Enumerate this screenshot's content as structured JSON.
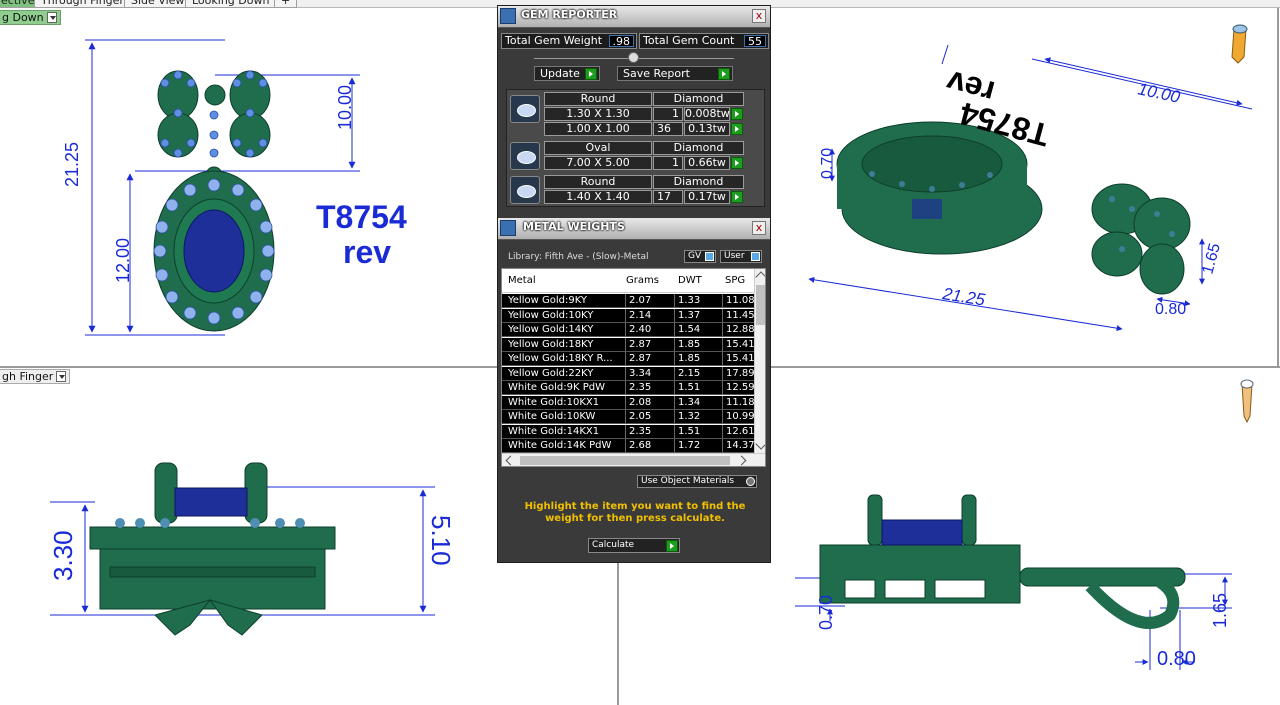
{
  "tabs": [
    "ective",
    "Through Finger",
    "Side View",
    "Looking Down",
    "+"
  ],
  "viewports": {
    "top_left_label": "g Down",
    "bottom_left_label": "gh Finger",
    "top_left": {
      "text_line1": "T8754",
      "text_line2": "rev",
      "dim_total": "21.25",
      "dim_top": "10.00",
      "dim_bottom": "12.00"
    },
    "top_right": {
      "dim_width": "10.00",
      "dim_length": "21.25",
      "dim_a": "0.70",
      "dim_b": "1.65",
      "dim_c": "0.80",
      "engraving_1": "T8754",
      "engraving_2": "rev"
    },
    "bottom_left": {
      "dim_left": "3.30",
      "dim_right": "5.10"
    },
    "bottom_right": {
      "dim_a": "0.70",
      "dim_b": "1.65",
      "dim_c": "0.80"
    }
  },
  "gem_reporter": {
    "title": "GEM REPORTER",
    "close": "x",
    "total_weight_label": "Total Gem Weight",
    "total_weight_value": ".98",
    "total_count_label": "Total Gem Count",
    "total_count_value": "55",
    "update_label": "Update",
    "save_label": "Save Report",
    "groups": [
      {
        "shape": "Round",
        "material": "Diamond",
        "rows": [
          {
            "size": "1.30 X 1.30",
            "count": "1",
            "weight": "0.008tw"
          },
          {
            "size": "1.00 X 1.00",
            "count": "36",
            "weight": "0.13tw"
          }
        ]
      },
      {
        "shape": "Oval",
        "material": "Diamond",
        "rows": [
          {
            "size": "7.00 X 5.00",
            "count": "1",
            "weight": "0.66tw"
          }
        ]
      },
      {
        "shape": "Round",
        "material": "Diamond",
        "rows": [
          {
            "size": "1.40 X 1.40",
            "count": "17",
            "weight": "0.17tw"
          }
        ]
      }
    ]
  },
  "metal_weights": {
    "title": "METAL WEIGHTS",
    "close": "x",
    "library": "Library: Fifth Ave - (Slow)-Metal",
    "gv_label": "GV",
    "user_label": "User",
    "columns": [
      "Metal",
      "Grams",
      "DWT",
      "SPG"
    ],
    "rows": [
      [
        "Yellow Gold:9KY",
        "2.07",
        "1.33",
        "11.08"
      ],
      [
        "Yellow Gold:10KY",
        "2.14",
        "1.37",
        "11.45"
      ],
      [
        "Yellow Gold:14KY",
        "2.40",
        "1.54",
        "12.88"
      ],
      [
        "Yellow Gold:18KY",
        "2.87",
        "1.85",
        "15.41"
      ],
      [
        "Yellow Gold:18KY R...",
        "2.87",
        "1.85",
        "15.41"
      ],
      [
        "Yellow Gold:22KY",
        "3.34",
        "2.15",
        "17.89"
      ],
      [
        "White Gold:9K PdW",
        "2.35",
        "1.51",
        "12.59"
      ],
      [
        "White Gold:10KX1",
        "2.08",
        "1.34",
        "11.18"
      ],
      [
        "White Gold:10KW",
        "2.05",
        "1.32",
        "10.99"
      ],
      [
        "White Gold:14KX1",
        "2.35",
        "1.51",
        "12.61"
      ],
      [
        "White Gold:14K PdW",
        "2.68",
        "1.72",
        "14.37"
      ]
    ],
    "use_object_materials": "Use Object Materials",
    "hint": "Highlight the item you want to find the weight for then press calculate.",
    "calculate": "Calculate"
  },
  "colors": {
    "metal": "#1f7a52",
    "gem_blue": "#1e2f9a",
    "dimension": "#1a2bd6",
    "accent_green": "#1e9c1e"
  }
}
